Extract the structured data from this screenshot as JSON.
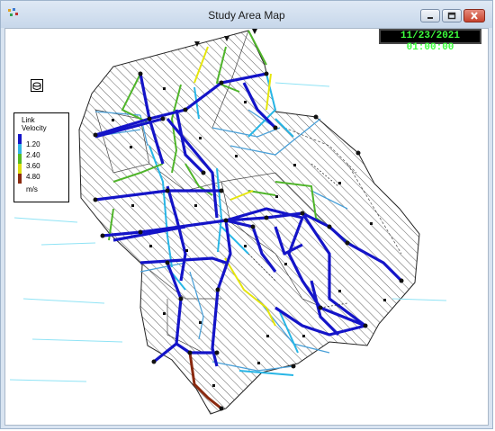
{
  "window": {
    "title": "Study Area Map"
  },
  "clock": {
    "datetime": "11/23/2021 01:00:00"
  },
  "legend": {
    "title_line1": "Link",
    "title_line2": "Velocity",
    "items": [
      {
        "label": "1.20",
        "color": "#1414c8"
      },
      {
        "label": "2.40",
        "color": "#33b5e5"
      },
      {
        "label": "3.60",
        "color": "#55bb22"
      },
      {
        "label": "4.80",
        "color": "#dede10"
      },
      {
        "label": "m/s",
        "color": "#8a2a10"
      }
    ]
  },
  "icons": [
    "app-icon",
    "minimize-icon",
    "maximize-icon",
    "close-icon",
    "nodes-icon"
  ]
}
